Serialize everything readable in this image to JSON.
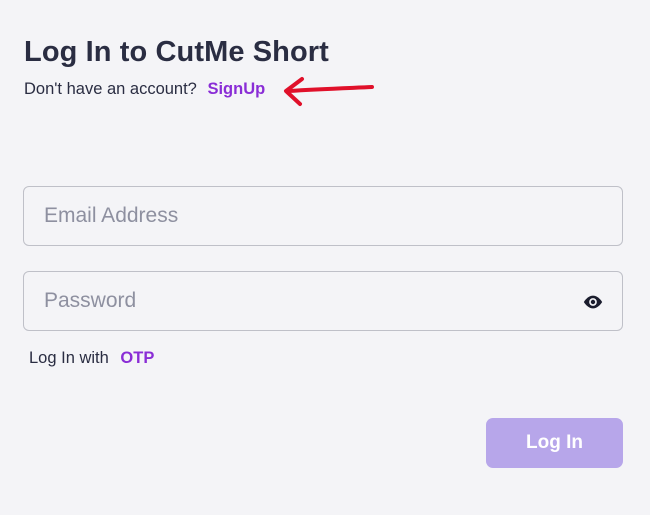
{
  "header": {
    "title": "Log In to CutMe Short",
    "signup_prompt": "Don't have an account?",
    "signup_link": "SignUp"
  },
  "form": {
    "email": {
      "placeholder": "Email Address",
      "value": ""
    },
    "password": {
      "placeholder": "Password",
      "value": ""
    },
    "otp_prompt": "Log In with",
    "otp_link": "OTP",
    "submit_label": "Log In"
  },
  "icons": {
    "password_toggle": "eye-icon",
    "annotation": "red-arrow-icon"
  },
  "colors": {
    "background": "#f4f4f7",
    "text": "#2a2d42",
    "link": "#8a2dd6",
    "button_disabled": "#b7a6ea",
    "annotation_arrow": "#e0102a"
  }
}
